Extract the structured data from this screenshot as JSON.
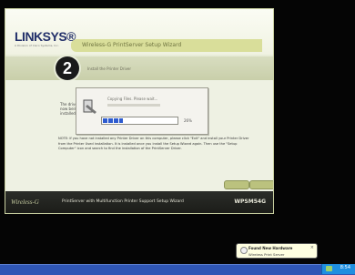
{
  "wizard": {
    "logo": "LINKSYS®",
    "logo_sub": "A Division of Cisco Systems, Inc.",
    "title": "Wireless-G PrintServer Setup Wizard",
    "step_number": "2",
    "subtitle": "Install the Printer Driver",
    "side_text": "The driver is now being installed.",
    "note": "NOTE: If you have not installed any Printer Driver on this computer, please click \"Exit\" and install your Printer Driver from the Printer Used installation. It is installed once you install the Setup Wizard again. Then use the \"Setup Computer\" icon and search to find the installation of the PrintServer Driver.",
    "footer_brand": "Wireless-G",
    "footer_text": "PrintServer with Multifunction Printer Support   Setup Wizard",
    "footer_model": "WPSM54G"
  },
  "dialog": {
    "text": "Copying Files. Please wait...",
    "progress": 0.26,
    "percent": "26%"
  },
  "balloon": {
    "title": "Found New Hardware",
    "text": "Wireless Print Server",
    "close": "×"
  },
  "taskbar": {
    "time": "8:54"
  },
  "colors": {
    "footer": "#1f201b",
    "accent": "#d9de9a",
    "taskbar": "#2f56b5",
    "progress": "#2d5bcf"
  }
}
